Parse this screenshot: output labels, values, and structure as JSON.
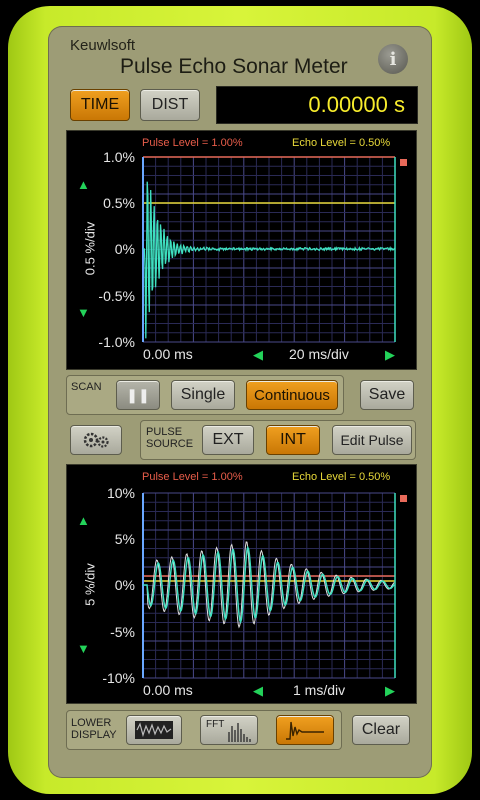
{
  "header": {
    "brand": "Keuwlsoft",
    "title": "Pulse Echo Sonar Meter",
    "info_label": "i"
  },
  "mode": {
    "time_label": "TIME",
    "dist_label": "DIST",
    "readout": "0.00000 s"
  },
  "upper_scope": {
    "pulse_level": "Pulse Level = 1.00%",
    "echo_level": "Echo Level = 0.50%",
    "y_ticks": [
      "1.0%",
      "0.5%",
      "0%",
      "-0.5%",
      "-1.0%"
    ],
    "y_unit": "0.5 %/div",
    "x_start": "0.00 ms",
    "x_scale": "20 ms/div"
  },
  "scan": {
    "label": "SCAN",
    "pause_label": "❚❚",
    "single_label": "Single",
    "continuous_label": "Continuous",
    "save_label": "Save"
  },
  "pulse_source": {
    "label_line1": "PULSE",
    "label_line2": "SOURCE",
    "ext_label": "EXT",
    "int_label": "INT",
    "edit_label": "Edit Pulse"
  },
  "lower_scope": {
    "pulse_level": "Pulse Level = 1.00%",
    "echo_level": "Echo Level = 0.50%",
    "y_ticks": [
      "10%",
      "5%",
      "0%",
      "-5%",
      "-10%"
    ],
    "y_unit": "5 %/div",
    "x_start": "0.00 ms",
    "x_scale": "1 ms/div"
  },
  "lower_display": {
    "label_line1": "LOWER",
    "label_line2": "DISPLAY",
    "fft_label": "FFT",
    "clear_label": "Clear"
  },
  "colors": {
    "casing": "#c7ea2a",
    "active": "#f0a020",
    "trace": "#3fe0c0",
    "pulse_line": "#e86a5a",
    "echo_line": "#e8d93a"
  }
}
